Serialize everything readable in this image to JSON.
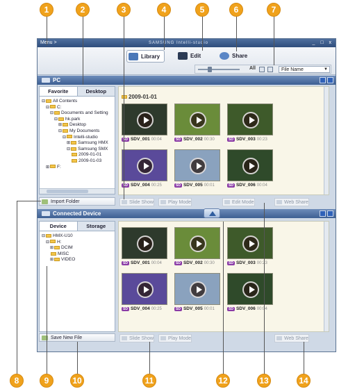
{
  "window": {
    "menu": "Menu >",
    "app_title": "SAMSUNG Intelli-studio",
    "controls": "_ □ x"
  },
  "toolbar": {
    "modes": [
      {
        "label": "Library",
        "icon": "library-icon"
      },
      {
        "label": "Edit",
        "icon": "edit-icon"
      },
      {
        "label": "Share",
        "icon": "share-icon"
      }
    ],
    "view_all": "All",
    "sort_select": "File Name"
  },
  "pc_panel": {
    "title": "PC",
    "tabs": [
      "Favorite",
      "Desktop"
    ],
    "tree": [
      {
        "label": "All Contents",
        "depth": 0,
        "exp": "−"
      },
      {
        "label": "C:",
        "depth": 1,
        "exp": "−"
      },
      {
        "label": "Documents and Setting",
        "depth": 2,
        "exp": "−"
      },
      {
        "label": "hk.park",
        "depth": 3,
        "exp": "−"
      },
      {
        "label": "Desktop",
        "depth": 4,
        "exp": "+"
      },
      {
        "label": "My Documents",
        "depth": 4,
        "exp": "−"
      },
      {
        "label": "Intelli-studio",
        "depth": 5,
        "exp": "−"
      },
      {
        "label": "Samsung HMX",
        "depth": 6,
        "exp": "+"
      },
      {
        "label": "Samsung SMX",
        "depth": 6,
        "exp": "−"
      },
      {
        "label": "2009-01-01",
        "depth": 7,
        "exp": ""
      },
      {
        "label": "2009-01-03",
        "depth": 7,
        "exp": ""
      },
      {
        "label": "F:",
        "depth": 1,
        "exp": "+"
      }
    ],
    "import_button": "Import Folder",
    "date_group": "2009-01-01",
    "thumbnails": [
      {
        "badge": "SD",
        "name": "SDV_001",
        "duration": "00:04",
        "bg": "#2e3a2c"
      },
      {
        "badge": "SD",
        "name": "SDV_002",
        "duration": "00:30",
        "bg": "#6a8c3a"
      },
      {
        "badge": "SD",
        "name": "SDV_003",
        "duration": "00:23",
        "bg": "#3e5a2a"
      },
      {
        "badge": "SD",
        "name": "SDV_004",
        "duration": "00:25",
        "bg": "#5a4a9a"
      },
      {
        "badge": "SD",
        "name": "SDV_005",
        "duration": "00:01",
        "bg": "#8aa2be"
      },
      {
        "badge": "SD",
        "name": "SDV_006",
        "duration": "00:04",
        "bg": "#2f4a2a"
      }
    ],
    "bottom_buttons": [
      "Slide Show",
      "Play Mode",
      "Edit Mode",
      "Web Share"
    ]
  },
  "device_panel": {
    "title": "Connected Device",
    "tabs": [
      "Device",
      "Storage"
    ],
    "tree": [
      {
        "label": "HMX-U10",
        "depth": 0,
        "exp": "−"
      },
      {
        "label": "H:",
        "depth": 1,
        "exp": "−"
      },
      {
        "label": "DCIM",
        "depth": 2,
        "exp": "+"
      },
      {
        "label": "MISC",
        "depth": 2,
        "exp": ""
      },
      {
        "label": "VIDEO",
        "depth": 2,
        "exp": "+"
      }
    ],
    "save_button": "Save New File",
    "thumbnails": [
      {
        "badge": "SD",
        "name": "SDV_001",
        "duration": "00:04",
        "bg": "#2e3a2c"
      },
      {
        "badge": "SD",
        "name": "SDV_002",
        "duration": "00:30",
        "bg": "#6a8c3a"
      },
      {
        "badge": "SD",
        "name": "SDV_003",
        "duration": "00:23",
        "bg": "#3e5a2a"
      },
      {
        "badge": "SD",
        "name": "SDV_004",
        "duration": "00:25",
        "bg": "#5a4a9a"
      },
      {
        "badge": "SD",
        "name": "SDV_005",
        "duration": "00:01",
        "bg": "#8aa2be"
      },
      {
        "badge": "SD",
        "name": "SDV_006",
        "duration": "00:04",
        "bg": "#2f4a2a"
      }
    ],
    "bottom_buttons": [
      "Slide Show",
      "Play Mode",
      "Web Share"
    ]
  },
  "callouts": [
    "1",
    "2",
    "3",
    "4",
    "5",
    "6",
    "7",
    "8",
    "9",
    "10",
    "11",
    "12",
    "13",
    "14"
  ],
  "colors": {
    "callout": "#f0a21c",
    "panel_bar": "#3d5f92",
    "sd_badge": "#8a3aa6"
  }
}
